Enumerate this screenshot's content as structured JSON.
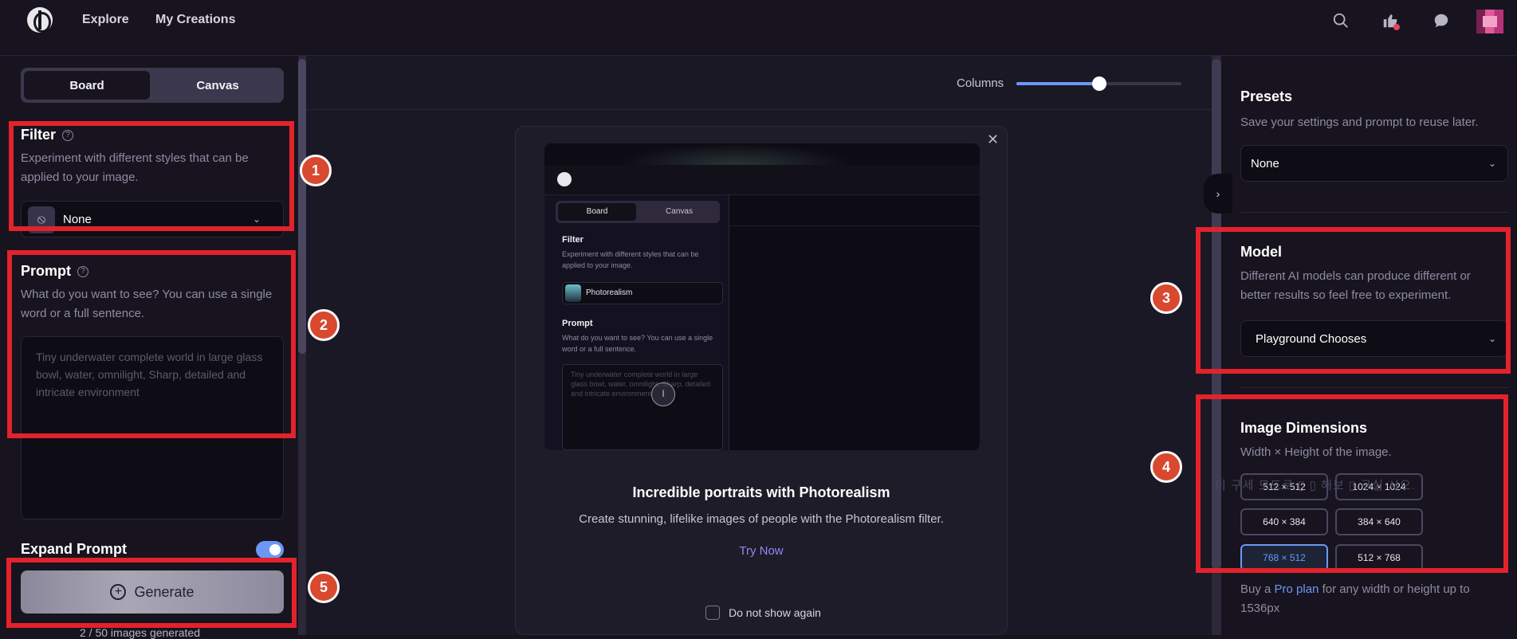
{
  "nav": {
    "explore": "Explore",
    "my_creations": "My Creations",
    "icons": [
      "search-icon",
      "thumbs-up-icon",
      "chat-bubble-icon"
    ]
  },
  "left": {
    "tabs": {
      "board": "Board",
      "canvas": "Canvas"
    },
    "filter": {
      "title": "Filter",
      "description": "Experiment with different styles that can be applied to your image.",
      "value": "None"
    },
    "prompt": {
      "title": "Prompt",
      "description": "What do you want to see? You can use a single word or a full sentence.",
      "placeholder": "Tiny underwater complete world in large glass bowl, water, omnilight, Sharp, detailed and intricate environment"
    },
    "expand_prompt": {
      "label": "Expand Prompt",
      "enabled": true
    },
    "generate_label": "Generate",
    "images_generated": "2 / 50 images generated"
  },
  "center": {
    "columns_label": "Columns",
    "columns_value_fraction": 0.5,
    "modal": {
      "title": "Incredible portraits with Photorealism",
      "description": "Create stunning, lifelike images of people with the Photorealism filter.",
      "cta": "Try Now",
      "dont_show": "Do not show again",
      "preview": {
        "board": "Board",
        "canvas": "Canvas",
        "filter_title": "Filter",
        "filter_desc": "Experiment with different styles that can be applied to your image.",
        "filter_value": "Photorealism",
        "prompt_title": "Prompt",
        "prompt_desc": "What do you want to see? You can use a single word or a full sentence.",
        "prompt_placeholder": "Tiny underwater complete world in large glass bowl, water, omnilight, Sharp, detailed and intricate environment"
      }
    }
  },
  "right": {
    "presets": {
      "title": "Presets",
      "description": "Save your settings and prompt to reuse later.",
      "value": "None"
    },
    "model": {
      "title": "Model",
      "description": "Different AI models can produce different or better results so feel free to experiment.",
      "value": "Playground Chooses"
    },
    "dimensions": {
      "title": "Image Dimensions",
      "description": "Width × Height of the image.",
      "options": [
        "512 × 512",
        "1024 × 1024",
        "640 × 384",
        "384 × 640",
        "768 × 512",
        "512 × 768"
      ],
      "selected": "768 × 512"
    },
    "pro_note_prefix": "Buy a ",
    "pro_note_link": "Pro plan",
    "pro_note_suffix": " for any width or height up to 1536px",
    "ghost_text": "이 구세 모드로 ▯ ▯ 해보 ▯ 구실 시오."
  },
  "annotations": [
    "1",
    "2",
    "3",
    "4",
    "5"
  ],
  "colors": {
    "background": "#17141f",
    "accent": "#6c97f5",
    "annotation_red": "#e3222b",
    "badge": "#d8492f",
    "link": "#8f8af5"
  }
}
